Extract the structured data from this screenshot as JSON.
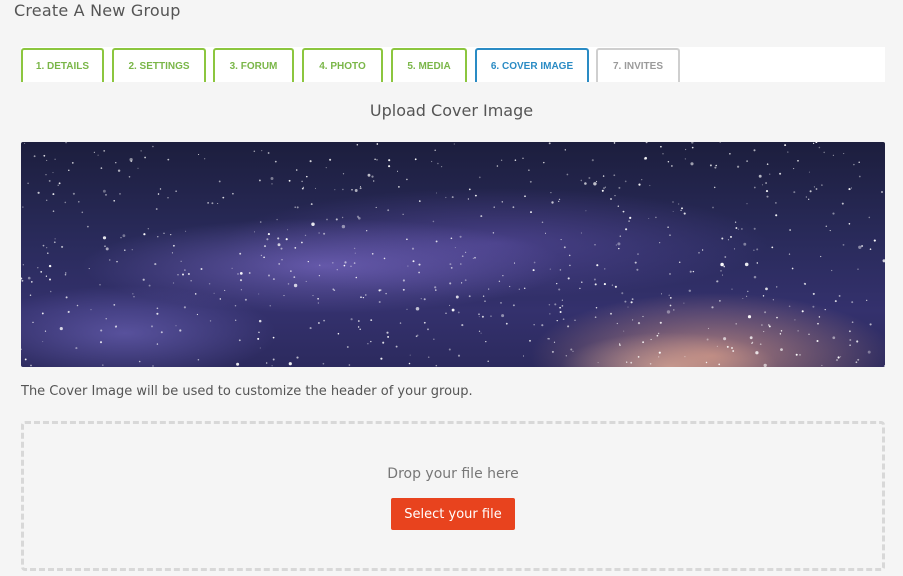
{
  "page": {
    "title": "Create A New Group"
  },
  "tabs": [
    {
      "label": "1. Details"
    },
    {
      "label": "2. Settings"
    },
    {
      "label": "3. Forum"
    },
    {
      "label": "4. Photo"
    },
    {
      "label": "5. Media"
    },
    {
      "label": "6. Cover Image"
    },
    {
      "label": "7. Invites"
    }
  ],
  "colors": {
    "tab_complete": "#8cc63f",
    "tab_active": "#2a8bc4",
    "tab_pending": "#cfcfcf",
    "button": "#e8431e"
  },
  "cover": {
    "heading": "Upload Cover Image",
    "description": "The Cover Image will be used to customize the header of your group."
  },
  "dropzone": {
    "text": "Drop your file here",
    "button_label": "Select your file"
  }
}
